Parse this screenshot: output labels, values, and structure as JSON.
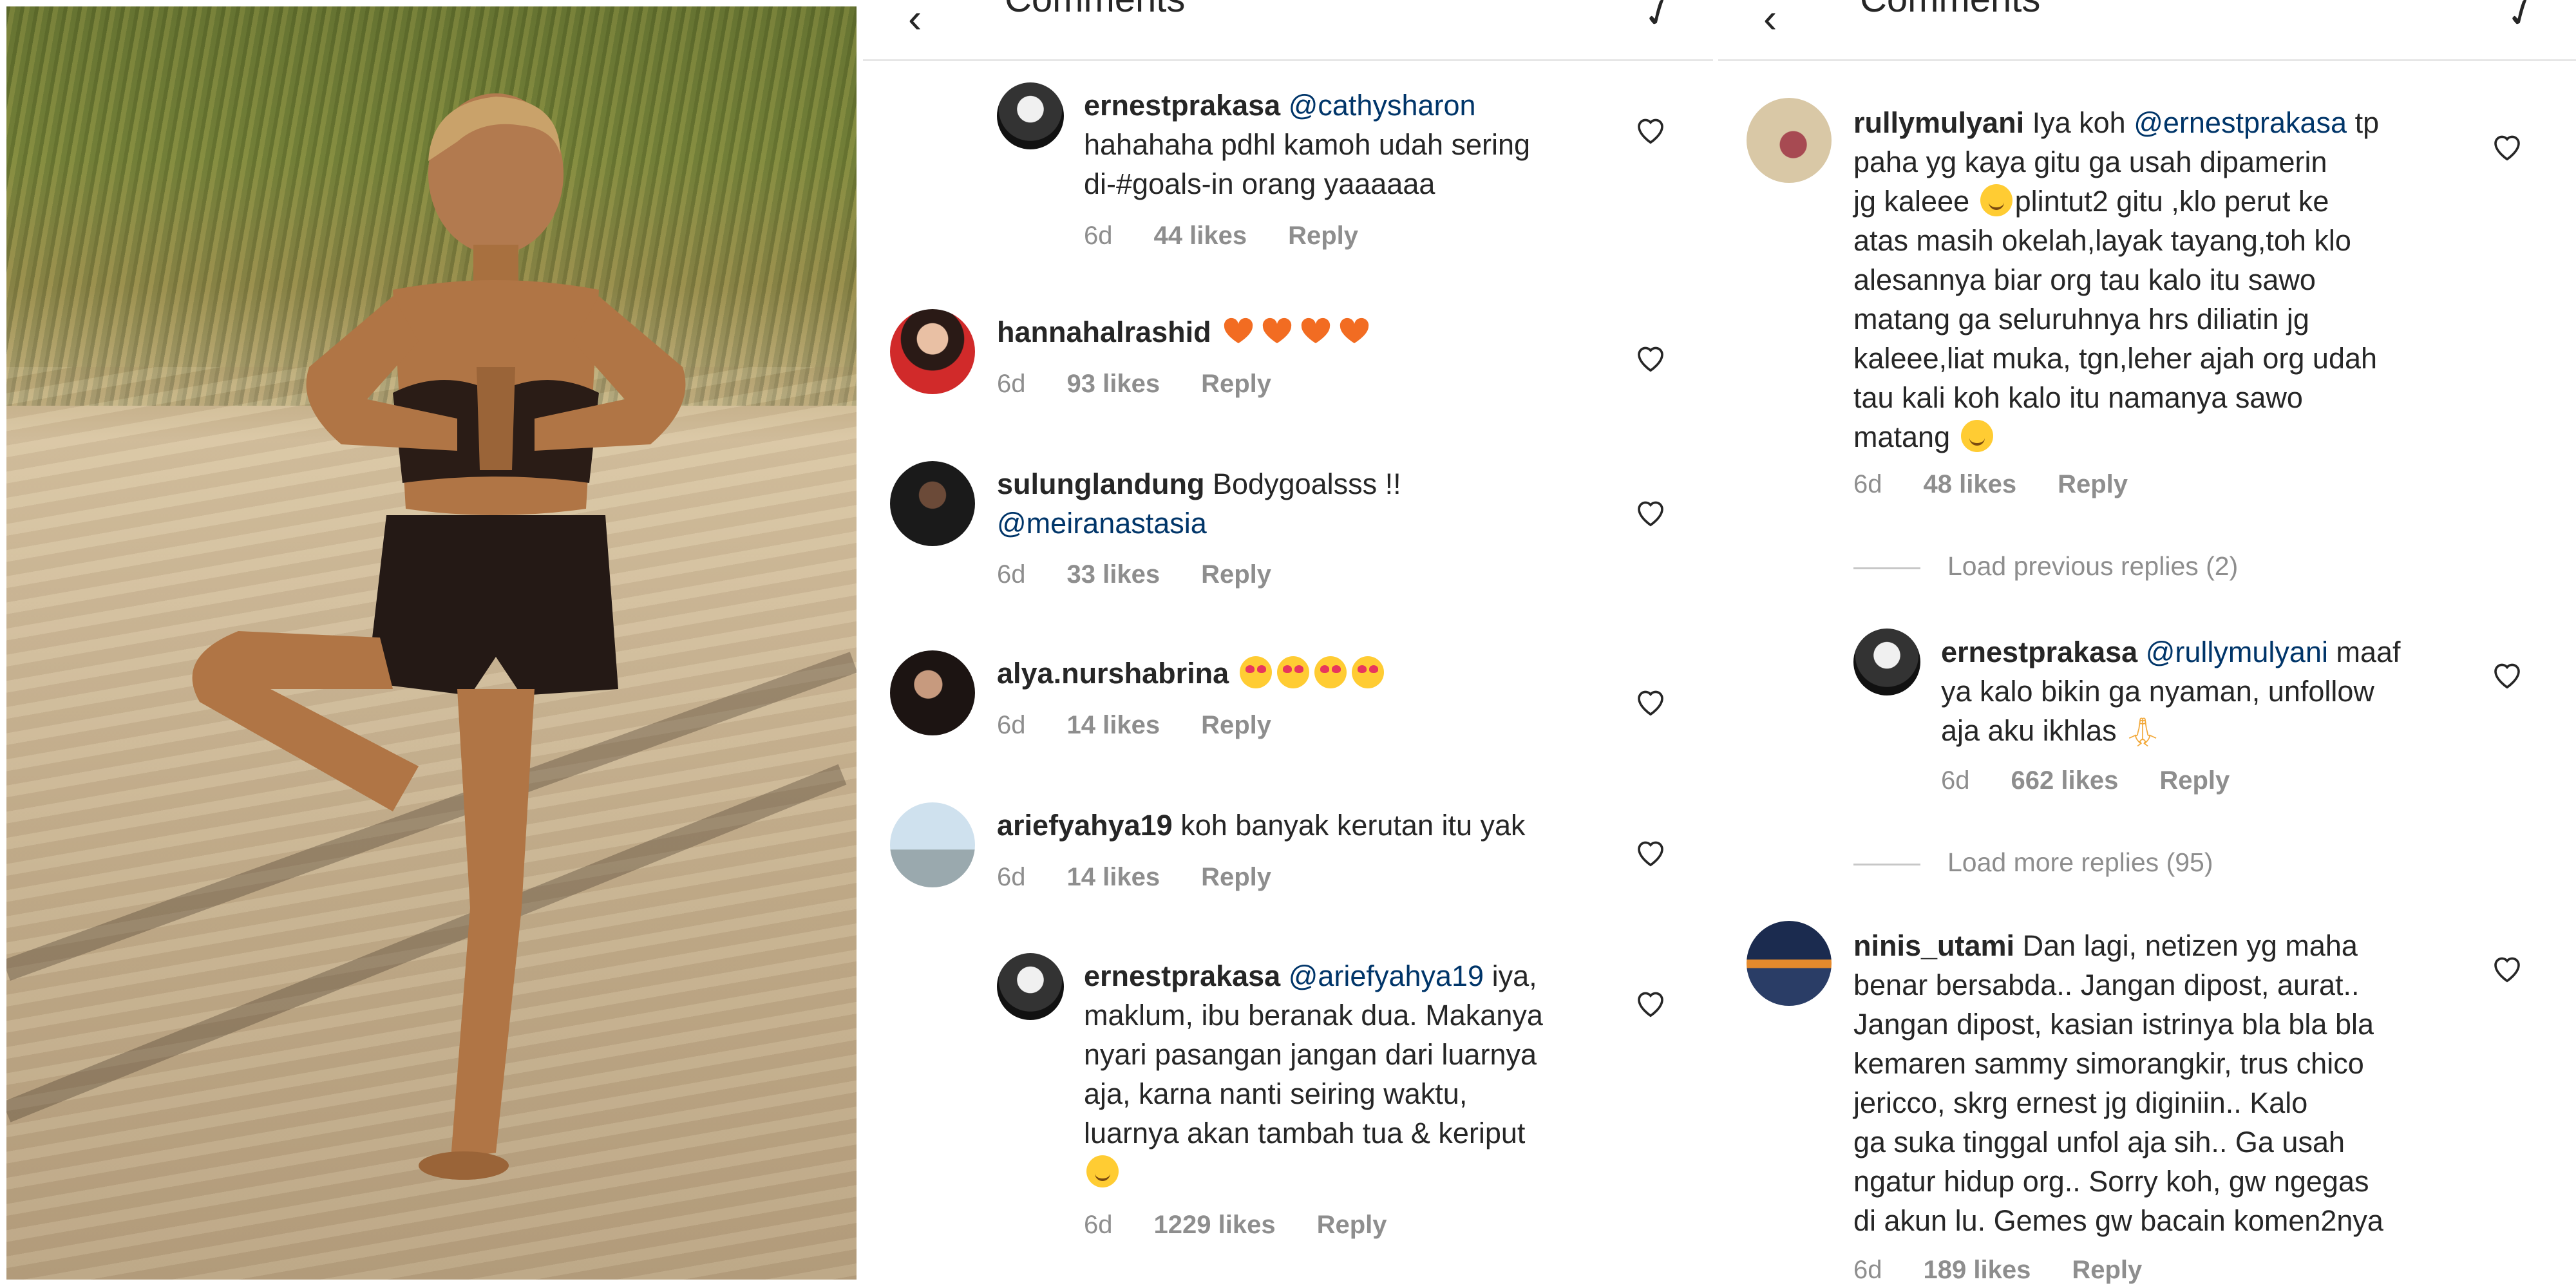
{
  "header": {
    "title": "Comments"
  },
  "panel_a": {
    "comments": [
      {
        "user": "ernestprakasa",
        "mention": "@cathysharon",
        "text_lines": [
          "hahahaha pdhl kamoh udah sering",
          "di-#goals-in orang yaaaaaa"
        ],
        "time": "6d",
        "likes": "44 likes",
        "reply": "Reply"
      },
      {
        "user": "hannahalrashid",
        "text": "",
        "time": "6d",
        "likes": "93 likes",
        "reply": "Reply"
      },
      {
        "user": "sulunglandung",
        "text": "Bodygoalsss !!",
        "mention2": "@meiranastasia",
        "time": "6d",
        "likes": "33 likes",
        "reply": "Reply"
      },
      {
        "user": "alya.nurshabrina",
        "text": "",
        "time": "6d",
        "likes": "14 likes",
        "reply": "Reply"
      },
      {
        "user": "ariefyahya19",
        "text": "koh banyak kerutan itu yak",
        "time": "6d",
        "likes": "14 likes",
        "reply": "Reply"
      },
      {
        "user": "ernestprakasa",
        "mention": "@ariefyahya19",
        "first": "iya,",
        "text_lines": [
          "maklum, ibu beranak dua. Makanya",
          "nyari pasangan jangan dari luarnya",
          "aja, karna nanti seiring waktu,",
          "luarnya akan tambah tua & keriput"
        ],
        "time": "6d",
        "likes": "1229 likes",
        "reply": "Reply"
      }
    ]
  },
  "panel_b": {
    "comments": [
      {
        "user": "rullymulyani",
        "first": "Iya koh",
        "mention": "@ernestprakasa",
        "after": "tp",
        "text_lines": [
          "paha yg kaya gitu ga usah dipamerin",
          "jg kaleee",
          "plintut2 gitu ,klo perut ke",
          "atas masih okelah,layak tayang,toh klo",
          "alesannya biar org tau kalo itu sawo",
          "matang ga seluruhnya hrs diliatin jg",
          "kaleee,liat muka, tgn,leher ajah org udah",
          "tau kali koh kalo itu namanya sawo",
          "matang"
        ],
        "time": "6d",
        "likes": "48 likes",
        "reply": "Reply"
      },
      {
        "load": "Load previous replies (2)"
      },
      {
        "user": "ernestprakasa",
        "mention": "@rullymulyani",
        "after": "maaf",
        "text_lines": [
          "ya kalo bikin ga nyaman, unfollow",
          "aja aku ikhlas"
        ],
        "time": "6d",
        "likes": "662 likes",
        "reply": "Reply"
      },
      {
        "load": "Load more replies (95)"
      },
      {
        "user": "ninis_utami",
        "first": "Dan lagi,",
        "text_lines": [
          "netizen yg maha",
          "benar bersabda.. Jangan dipost, aurat..",
          "Jangan dipost, kasian istrinya bla bla bla",
          "kemaren sammy simorangkir, trus  chico",
          "jericco, skrg ernest jg diginiin.. Kalo",
          "ga suka tinggal unfol aja sih.. Ga usah",
          "ngatur hidup org.. Sorry koh, gw ngegas",
          "di akun lu. Gemes gw bacain komen2nya"
        ],
        "time": "6d",
        "likes": "189 likes",
        "reply": "Reply"
      }
    ]
  },
  "colors": {
    "mention": "#003569",
    "meta": "#8e8e8e",
    "text": "#262626",
    "heart_emoji": "#f26c22"
  }
}
